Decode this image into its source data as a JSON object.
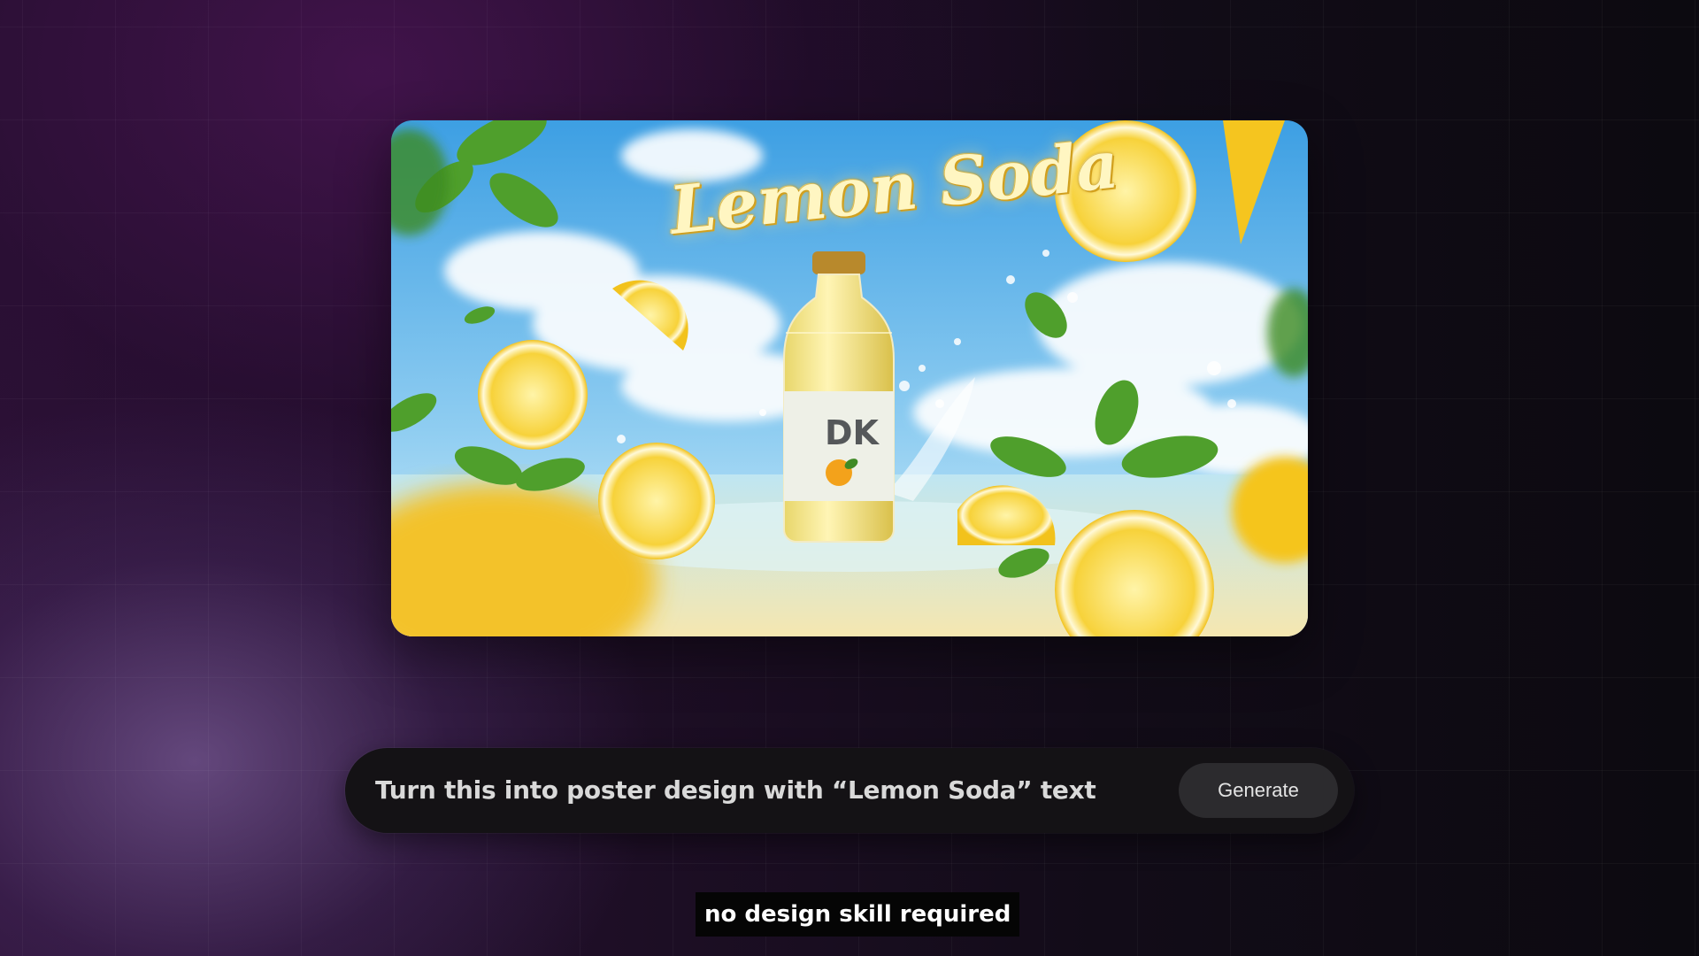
{
  "poster": {
    "headline": "Lemon Soda",
    "image_description_icon": "lemon-soda-bottle-image",
    "colors": {
      "sky": "#4aa9e6",
      "lemon": "#f6cf2e",
      "mint": "#4fa12e",
      "text_glow": "#fff6c2"
    }
  },
  "prompt": {
    "text": "Turn this into poster design with “Lemon Soda” text",
    "button_label": "Generate"
  },
  "caption": {
    "text": "no design skill required"
  }
}
